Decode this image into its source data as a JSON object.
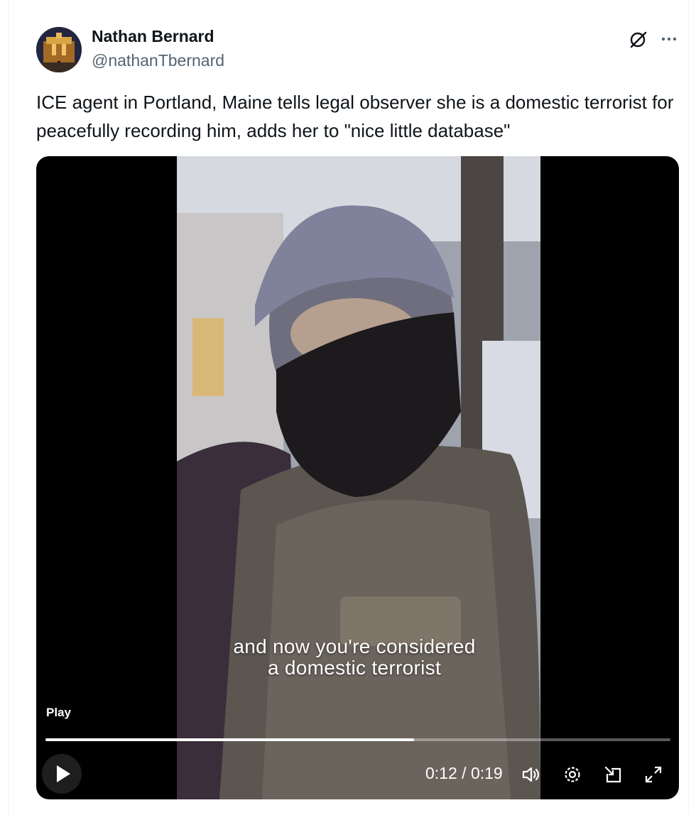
{
  "tweet": {
    "author_name": "Nathan Bernard",
    "author_handle": "@nathanTbernard",
    "text": "ICE agent in Portland, Maine tells legal observer she is a domestic terrorist for peacefully recording him, adds her to \"nice little database\""
  },
  "video": {
    "caption_line1": "and now you're considered",
    "caption_line2": "a domestic terrorist",
    "play_label": "Play",
    "current_time": "0:12",
    "separator": "/",
    "duration": "0:19",
    "progress": 0.59
  },
  "icons": {
    "header": [
      "grok-icon",
      "more-options-icon"
    ],
    "controls": [
      "play-icon",
      "volume-icon",
      "settings-icon",
      "pip-icon",
      "fullscreen-icon"
    ]
  }
}
